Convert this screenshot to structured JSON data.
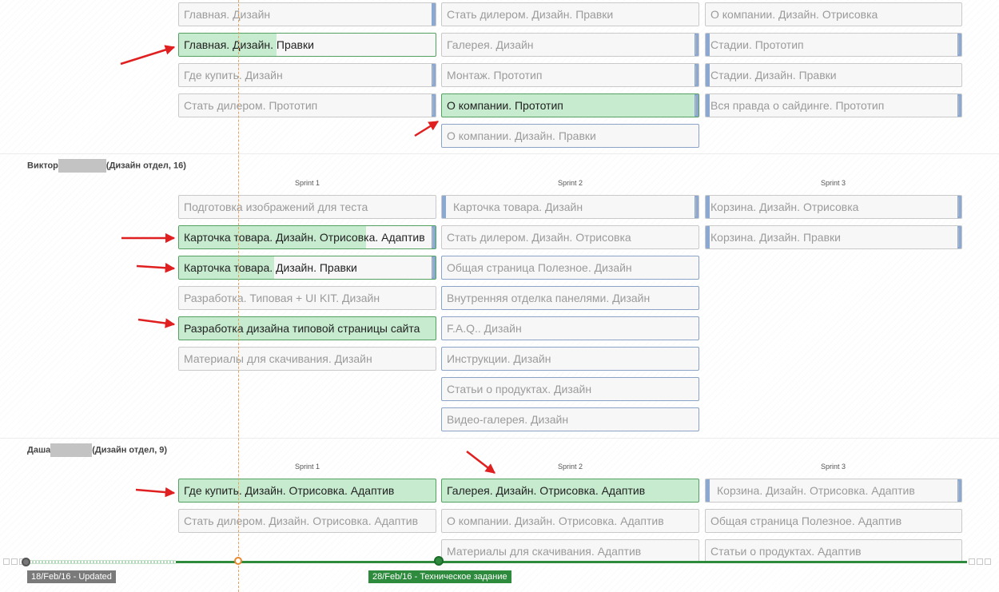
{
  "groups": {
    "top": {
      "col1": [
        "Главная. Дизайн",
        "Главная. Дизайн. Правки",
        "Где купить. Дизайн",
        "Стать дилером. Прототип"
      ],
      "col2": [
        "Стать дилером. Дизайн. Правки",
        "Галерея. Дизайн",
        "Монтаж. Прототип",
        "О компании. Прототип",
        "О компании. Дизайн. Правки"
      ],
      "col3": [
        "О компании. Дизайн. Отрисовка",
        "Стадии. Прототип",
        "Стадии. Дизайн. Правки",
        "Вся правда о сайдинге. Прототип"
      ]
    },
    "viktor": {
      "name": "Виктор",
      "dept": "(Дизайн отдел, 16)",
      "sprints": [
        "Sprint 1",
        "Sprint 2",
        "Sprint 3"
      ],
      "col1": [
        "Подготовка изображений для теста",
        "Карточка товара. Дизайн. Отрисовка. Адаптив",
        "Карточка товара. Дизайн. Правки",
        "Разработка. Типовая + UI KIT. Дизайн",
        "Разработка дизайна типовой страницы сайта",
        "Материалы для скачивания. Дизайн"
      ],
      "col2": [
        "Карточка товара. Дизайн",
        "Стать дилером. Дизайн. Отрисовка",
        "Общая страница Полезное. Дизайн",
        "Внутренняя отделка панелями. Дизайн",
        "F.A.Q.. Дизайн",
        "Инструкции. Дизайн",
        "Статьи о продуктах. Дизайн",
        "Видео-галерея. Дизайн"
      ],
      "col3": [
        "Корзина. Дизайн. Отрисовка",
        "Корзина. Дизайн. Правки"
      ]
    },
    "dasha": {
      "name": "Даша",
      "dept": "(Дизайн отдел, 9)",
      "sprints": [
        "Sprint 1",
        "Sprint 2",
        "Sprint 3"
      ],
      "col1": [
        "Где купить. Дизайн. Отрисовка. Адаптив",
        "Стать дилером. Дизайн. Отрисовка. Адаптив"
      ],
      "col2": [
        "Галерея. Дизайн. Отрисовка. Адаптив",
        "О компании. Дизайн. Отрисовка. Адаптив",
        "Материалы для скачивания. Адаптив"
      ],
      "col3": [
        "Корзина. Дизайн. Отрисовка. Адаптив",
        "Общая страница Полезное. Адаптив",
        "Статьи о продуктах. Адаптив"
      ]
    }
  },
  "progress": {
    "top_col1_1": 0.38,
    "viktor_col1_1": 0.73,
    "viktor_col1_2": 0.37
  },
  "timeline": {
    "updated_label": "18/Feb/16 - Updated",
    "milestone_label": "28/Feb/16 - Техническое задание"
  },
  "colors": {
    "done": "#c6ebcf",
    "done_border": "#54a061",
    "blocked_edge": "#8aa8d1",
    "timeline_green": "#2e8b3d",
    "today_line": "#e8a35c",
    "arrow": "#e02020"
  }
}
